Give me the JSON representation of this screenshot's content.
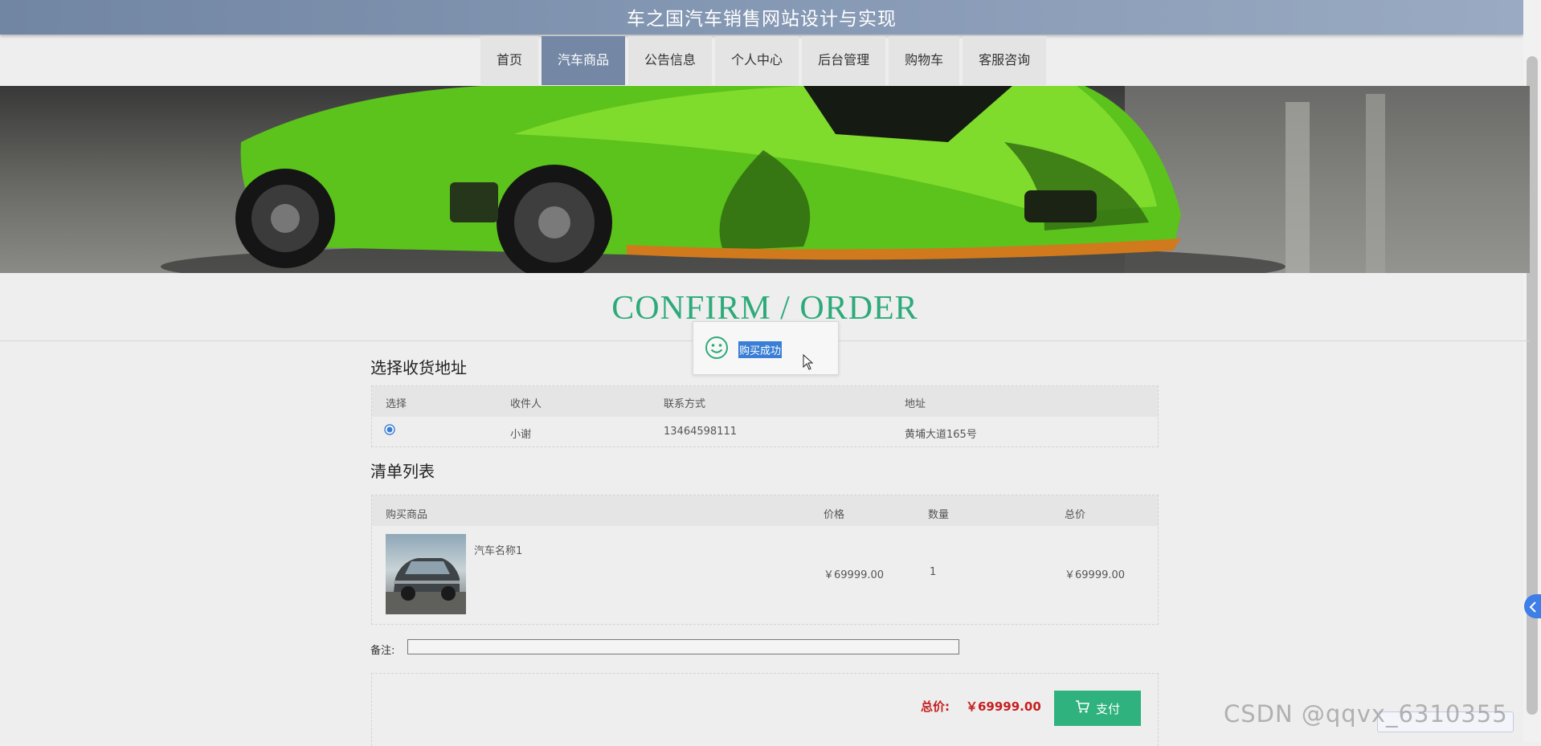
{
  "header": {
    "title": "车之国汽车销售网站设计与实现"
  },
  "nav": {
    "items": [
      {
        "label": "首页"
      },
      {
        "label": "汽车商品"
      },
      {
        "label": "公告信息"
      },
      {
        "label": "个人中心"
      },
      {
        "label": "后台管理"
      },
      {
        "label": "购物车"
      },
      {
        "label": "客服咨询"
      }
    ],
    "active_index": 1
  },
  "page": {
    "heading": "CONFIRM / ORDER"
  },
  "toast": {
    "message": "购买成功"
  },
  "address_section": {
    "title": "选择收货地址",
    "columns": [
      "选择",
      "收件人",
      "联系方式",
      "地址"
    ],
    "rows": [
      {
        "selected": true,
        "recipient": "小谢",
        "phone": "13464598111",
        "address": "黄埔大道165号"
      }
    ]
  },
  "order_section": {
    "title": "清单列表",
    "columns": [
      "购买商品",
      "价格",
      "数量",
      "总价"
    ],
    "items": [
      {
        "name": "汽车名称1",
        "price": "￥69999.00",
        "quantity": "1",
        "subtotal": "￥69999.00"
      }
    ]
  },
  "remark": {
    "label": "备注:",
    "value": ""
  },
  "summary": {
    "total_label": "总价:",
    "total_value": "￥69999.00",
    "pay_label": "支付"
  },
  "watermark": "CSDN @qqvx_6310355",
  "colors": {
    "header": "#7a8eaa",
    "nav_active": "#7488a5",
    "accent_green": "#2eaa7a",
    "price_red": "#c71e1e",
    "pay_button": "#2fb27d"
  },
  "icons": [
    "smile-icon",
    "cart-icon",
    "cursor-icon",
    "chevron-left-icon"
  ]
}
